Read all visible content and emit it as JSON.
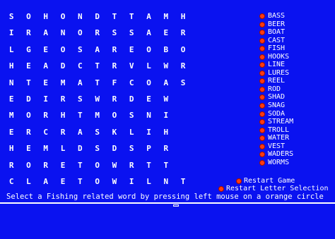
{
  "grid": [
    [
      "S",
      "O",
      "H",
      "O",
      "N",
      "D",
      "T",
      "T",
      "A",
      "M",
      "H",
      "",
      ""
    ],
    [
      "I",
      "R",
      "A",
      "N",
      "O",
      "R",
      "S",
      "S",
      "A",
      "E",
      "R",
      "",
      ""
    ],
    [
      "L",
      "G",
      "E",
      "O",
      "S",
      "A",
      "R",
      "E",
      "O",
      "B",
      "O",
      "",
      ""
    ],
    [
      "H",
      "E",
      "A",
      "D",
      "C",
      "T",
      "R",
      "V",
      "L",
      "W",
      "R",
      "",
      ""
    ],
    [
      "N",
      "T",
      "E",
      "M",
      "A",
      "T",
      "F",
      "C",
      "O",
      "A",
      "S",
      "",
      ""
    ],
    [
      "E",
      "D",
      "I",
      "R",
      "S",
      "W",
      "R",
      "D",
      "E",
      "W",
      "",
      ""
    ],
    [
      "M",
      "O",
      "R",
      "H",
      "T",
      "M",
      "O",
      "S",
      "N",
      "I",
      "",
      ""
    ],
    [
      "E",
      "R",
      "C",
      "R",
      "A",
      "S",
      "K",
      "L",
      "I",
      "H",
      "",
      ""
    ],
    [
      "H",
      "E",
      "M",
      "L",
      "D",
      "S",
      "D",
      "S",
      "P",
      "R",
      "",
      ""
    ],
    [
      "R",
      "O",
      "R",
      "E",
      "T",
      "O",
      "W",
      "R",
      "T",
      "T",
      "",
      ""
    ],
    [
      "C",
      "L",
      "A",
      "E",
      "T",
      "O",
      "W",
      "I",
      "L",
      "N",
      "T",
      "",
      ""
    ]
  ],
  "words": [
    "BASS",
    "BEER",
    "BOAT",
    "CAST",
    "FISH",
    "HOOKS",
    "LINE",
    "LURES",
    "REEL",
    "ROD",
    "SHAD",
    "SNAG",
    "SODA",
    "STREAM",
    "TROLL",
    "WATER",
    "VEST",
    "WADERS",
    "WORMS"
  ],
  "controls": {
    "restart_game": "Restart Game",
    "restart_letter": "Restart Letter Selection"
  },
  "status": "Select a Fishing related word by pressing left mouse on a orange circle",
  "colors": {
    "background": "#0a12f0",
    "text": "#ffffff",
    "circle": "#ff3b10"
  }
}
